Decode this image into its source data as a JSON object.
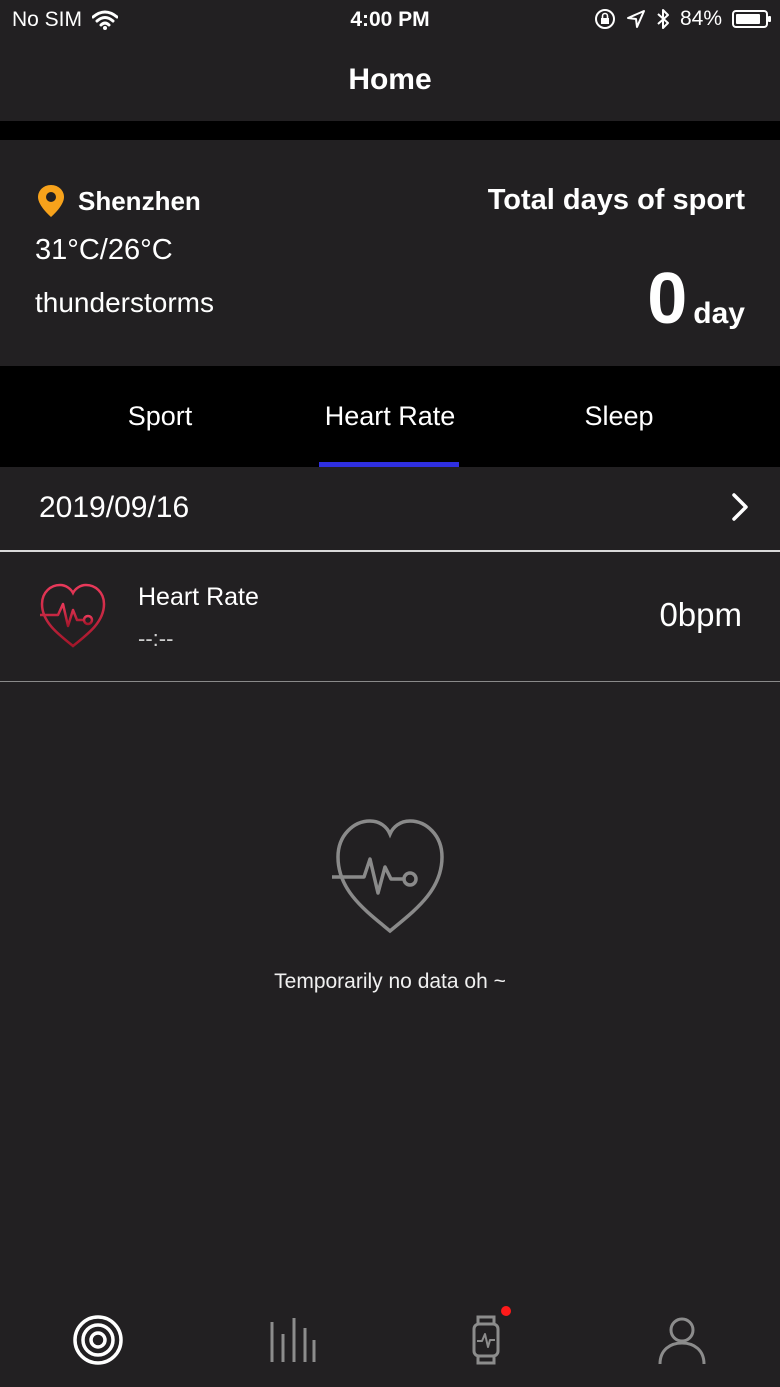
{
  "status": {
    "carrier": "No SIM",
    "time": "4:00 PM",
    "battery": "84%",
    "battery_level": 0.84
  },
  "nav": {
    "title": "Home"
  },
  "summary": {
    "city": "Shenzhen",
    "temperature": "31°C/26°C",
    "weather": "thunderstorms",
    "sport_title": "Total days of sport",
    "sport_days": "0",
    "sport_unit": "day"
  },
  "tabs": [
    {
      "label": "Sport",
      "active": false
    },
    {
      "label": "Heart Rate",
      "active": true
    },
    {
      "label": "Sleep",
      "active": false
    }
  ],
  "date": {
    "value": "2019/09/16"
  },
  "heart_rate": {
    "label": "Heart Rate",
    "time": "--:--",
    "value": "0bpm"
  },
  "empty_state": {
    "message": "Temporarily no data oh ~"
  },
  "colors": {
    "background": "#222022",
    "tab_bar_bg": "#000000",
    "tab_indicator": "#2f2fe0",
    "location_pin": "#f7a21b",
    "heart_gradient_start": "#e9395a",
    "heart_gradient_end": "#a4162a",
    "badge": "#ff1a1a"
  },
  "bottom_tabs": [
    {
      "icon": "target-icon",
      "active": true
    },
    {
      "icon": "bar-chart-icon",
      "active": false
    },
    {
      "icon": "smartwatch-icon",
      "active": false,
      "badge": true
    },
    {
      "icon": "person-icon",
      "active": false
    }
  ]
}
